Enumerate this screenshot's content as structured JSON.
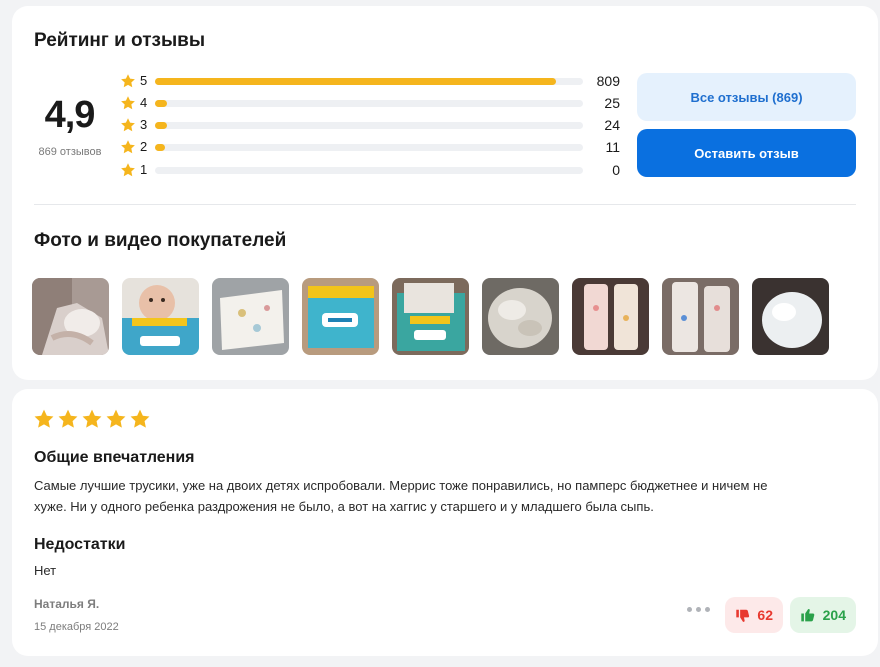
{
  "ratings": {
    "title": "Рейтинг и отзывы",
    "score": "4,9",
    "reviews_count_text": "869 отзывов",
    "star_color": "#f5b51d",
    "rows": [
      {
        "stars": "5",
        "count": "809",
        "fraction": 0.936
      },
      {
        "stars": "4",
        "count": "25",
        "fraction": 0.029
      },
      {
        "stars": "3",
        "count": "24",
        "fraction": 0.028
      },
      {
        "stars": "2",
        "count": "11",
        "fraction": 0.013
      },
      {
        "stars": "1",
        "count": "0",
        "fraction": 0
      }
    ],
    "all_reviews_label": "Все отзывы (869)",
    "write_review_label": "Оставить отзыв"
  },
  "media": {
    "title": "Фото и видео покупателей",
    "photos": [
      {
        "name": "photo-baby-legs"
      },
      {
        "name": "photo-baby-pampers-pack"
      },
      {
        "name": "photo-diaper-flat"
      },
      {
        "name": "photo-pampers-box"
      },
      {
        "name": "photo-pampers-box-open"
      },
      {
        "name": "photo-diaper-pile"
      },
      {
        "name": "photo-diapers-pink"
      },
      {
        "name": "photo-diapers-hanging"
      },
      {
        "name": "photo-diaper-white"
      }
    ]
  },
  "review": {
    "rating": 5,
    "impressions_heading": "Общие впечатления",
    "impressions_line1": "Самые лучшие трусики, уже на двоих детях испробовали. Меррис тоже понравились, но памперс бюджетнее и ничем не",
    "impressions_line2": "хуже. Ни у одного ребенка раздрожения не было, а вот на хаггис у старшего и у младшего была сыпь.",
    "cons_heading": "Недостатки",
    "cons_text": "Нет",
    "author": "Наталья Я.",
    "date": "15 декабря 2022",
    "dislikes": "62",
    "likes": "204",
    "dislike_color": "#e8392f",
    "like_color": "#2aa14a"
  }
}
